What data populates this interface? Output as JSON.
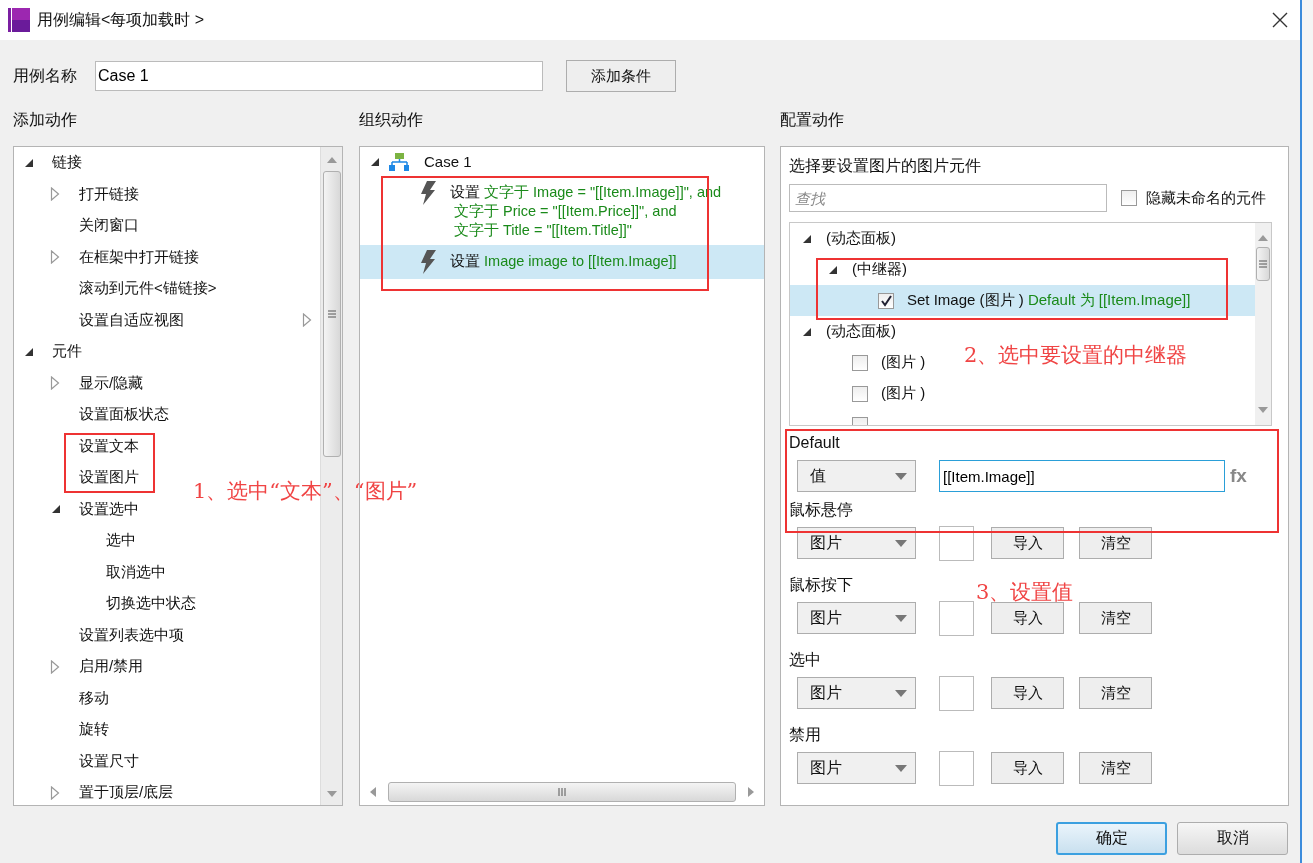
{
  "window": {
    "title": "用例编辑<每项加载时 >"
  },
  "case_name": {
    "label": "用例名称",
    "value": "Case 1"
  },
  "add_condition_button": "添加条件",
  "add_actions": {
    "heading": "添加动作",
    "items": [
      {
        "label": "链接",
        "kind": "node",
        "expanded": true,
        "children": [
          {
            "label": "打开链接",
            "kind": "node",
            "expanded": false
          },
          {
            "label": "关闭窗口",
            "kind": "node"
          },
          {
            "label": "在框架中打开链接",
            "kind": "node",
            "expanded": false
          },
          {
            "label": "滚动到元件<锚链接>",
            "kind": "node"
          },
          {
            "label": "设置自适应视图",
            "kind": "submenu"
          }
        ]
      },
      {
        "label": "元件",
        "kind": "node",
        "expanded": true,
        "children": [
          {
            "label": "显示/隐藏",
            "kind": "node",
            "expanded": false
          },
          {
            "label": "设置面板状态",
            "kind": "node"
          },
          {
            "label": "设置文本",
            "kind": "node"
          },
          {
            "label": "设置图片",
            "kind": "node"
          },
          {
            "label": "设置选中",
            "kind": "node",
            "expanded": true,
            "children": [
              {
                "label": "选中",
                "kind": "node"
              },
              {
                "label": "取消选中",
                "kind": "node"
              },
              {
                "label": "切换选中状态",
                "kind": "node"
              }
            ]
          },
          {
            "label": "设置列表选中项",
            "kind": "node"
          },
          {
            "label": "启用/禁用",
            "kind": "node",
            "expanded": false
          },
          {
            "label": "移动",
            "kind": "node"
          },
          {
            "label": "旋转",
            "kind": "node"
          },
          {
            "label": "设置尺寸",
            "kind": "node"
          },
          {
            "label": "置于顶层/底层",
            "kind": "node",
            "expanded": false
          }
        ]
      }
    ]
  },
  "organize_actions": {
    "heading": "组织动作",
    "case": {
      "label": "Case 1",
      "expanded": true,
      "actions": [
        {
          "selected": false,
          "lines": [
            [
              {
                "text": "设置 ",
                "kind": "plain"
              },
              {
                "text": "文字于 Image = \"[[Item.Image]]\", and",
                "kind": "target"
              }
            ],
            [
              {
                "text": "文字于 Price = \"[[Item.Price]]\", and",
                "kind": "target"
              }
            ],
            [
              {
                "text": "文字于 Title = \"[[Item.Title]]\"",
                "kind": "target"
              }
            ]
          ]
        },
        {
          "selected": true,
          "lines": [
            [
              {
                "text": "设置 ",
                "kind": "plain"
              },
              {
                "text": "Image image to [[Item.Image]]",
                "kind": "target"
              }
            ]
          ]
        }
      ]
    }
  },
  "configure_actions": {
    "heading": "配置动作",
    "subheading": "选择要设置图片的图片元件",
    "search": {
      "placeholder": "查找"
    },
    "hide_unnamed": {
      "label": "隐藏未命名的元件",
      "checked": false
    },
    "widgets": [
      {
        "kind": "group",
        "label": "(动态面板)",
        "expanded": true,
        "selected": false,
        "children": [
          {
            "kind": "group",
            "label": "(中继器)",
            "expanded": true,
            "selected": false,
            "children": [
              {
                "kind": "check",
                "checked": true,
                "selected": true,
                "segments": [
                  {
                    "text": "Set Image (图片 ) ",
                    "kind": "plain"
                  },
                  {
                    "text": "Default 为 [[Item.Image]]",
                    "kind": "target"
                  }
                ]
              }
            ]
          }
        ]
      },
      {
        "kind": "group",
        "label": "(动态面板)",
        "expanded": true,
        "selected": false,
        "children": [
          {
            "kind": "check",
            "checked": false,
            "selected": false,
            "segments": [
              {
                "text": "(图片 )",
                "kind": "plain"
              }
            ]
          },
          {
            "kind": "check",
            "checked": false,
            "selected": false,
            "segments": [
              {
                "text": "(图片 )",
                "kind": "plain"
              }
            ]
          },
          {
            "kind": "check",
            "checked": false,
            "selected": false
          }
        ]
      }
    ],
    "states": [
      {
        "label": "Default",
        "kind": "value",
        "select": "值",
        "value": "[[Item.Image]]",
        "fx": "fx"
      },
      {
        "label": "鼠标悬停",
        "kind": "image",
        "select": "图片",
        "buttons": [
          "导入",
          "清空"
        ]
      },
      {
        "label": "鼠标按下",
        "kind": "image",
        "select": "图片",
        "buttons": [
          "导入",
          "清空"
        ]
      },
      {
        "label": "选中",
        "kind": "image",
        "select": "图片",
        "buttons": [
          "导入",
          "清空"
        ]
      },
      {
        "label": "禁用",
        "kind": "image",
        "select": "图片",
        "buttons": [
          "导入",
          "清空"
        ]
      }
    ]
  },
  "buttons": [
    {
      "label": "确定",
      "kind": "primary"
    },
    {
      "label": "取消",
      "kind": "normal"
    }
  ],
  "annotations": [
    {
      "text": "1、选中“文本”、“图片”"
    },
    {
      "text": "2、选中要设置的中继器"
    },
    {
      "text": "3、设置值"
    }
  ]
}
